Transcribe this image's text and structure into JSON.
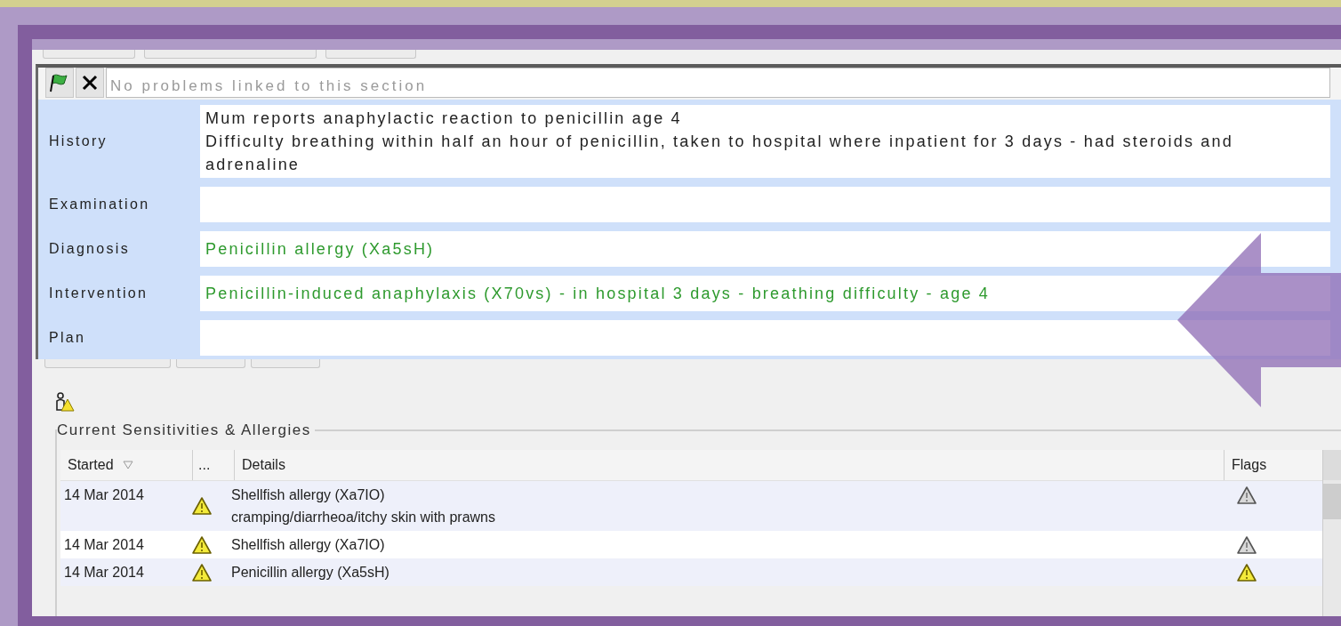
{
  "problem_bar": {
    "placeholder": "No problems linked to this section"
  },
  "consultation": [
    {
      "label": "History",
      "lines": [
        "Mum reports anaphylactic reaction to penicillin age 4",
        "Difficulty breathing within half an hour of penicillin, taken to hospital where inpatient for 3 days - had steroids and",
        "adrenaline"
      ],
      "coded": false
    },
    {
      "label": "Examination"
    },
    {
      "label": "Diagnosis",
      "lines": [
        "Penicillin allergy (Xa5sH)"
      ],
      "coded": true
    },
    {
      "label": "Intervention",
      "lines": [
        "Penicillin-induced anaphylaxis (X70vs) - in hospital 3 days - breathing difficulty - age 4"
      ],
      "coded": true
    },
    {
      "label": "Plan"
    }
  ],
  "sensitivities": {
    "title": "Current Sensitivities & Allergies",
    "columns": [
      "Started",
      "...",
      "Details",
      "Flags"
    ],
    "rows": [
      {
        "started": "14 Mar 2014",
        "details": [
          "Shellfish allergy (Xa7IO)",
          "cramping/diarrheoa/itchy skin with prawns"
        ],
        "flag_active": false
      },
      {
        "started": "14 Mar 2014",
        "details": [
          "Shellfish allergy (Xa7IO)"
        ],
        "flag_active": false
      },
      {
        "started": "14 Mar 2014",
        "details": [
          "Penicillin allergy (Xa5sH)"
        ],
        "flag_active": true
      }
    ]
  }
}
